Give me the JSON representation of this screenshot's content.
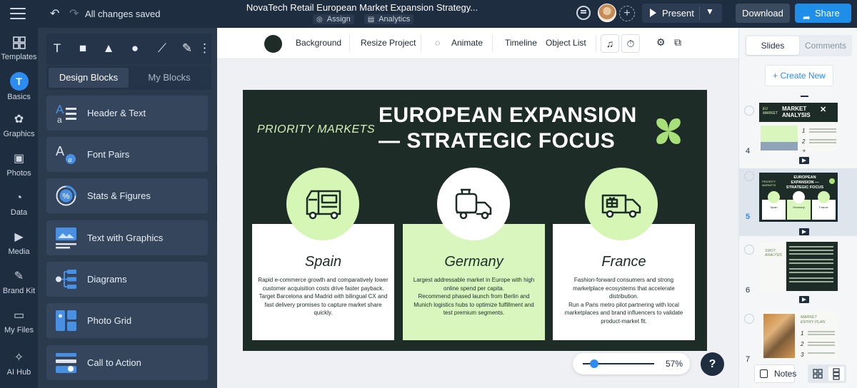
{
  "topbar": {
    "saved_status": "All changes saved",
    "title": "NovaTech Retail European Market Expansion Strategy...",
    "assign_label": "Assign",
    "analytics_label": "Analytics",
    "present_label": "Present",
    "download_label": "Download",
    "share_label": "Share"
  },
  "rail": {
    "items": [
      {
        "label": "Templates",
        "icon": "templates-icon"
      },
      {
        "label": "Basics",
        "icon": "basics-icon"
      },
      {
        "label": "Graphics",
        "icon": "graphics-icon"
      },
      {
        "label": "Photos",
        "icon": "photos-icon"
      },
      {
        "label": "Data",
        "icon": "data-icon"
      },
      {
        "label": "Media",
        "icon": "media-icon"
      },
      {
        "label": "Brand Kit",
        "icon": "brand-kit-icon"
      },
      {
        "label": "My Files",
        "icon": "my-files-icon"
      },
      {
        "label": "AI Hub",
        "icon": "ai-hub-icon"
      }
    ]
  },
  "panel": {
    "tab_design_blocks": "Design Blocks",
    "tab_my_blocks": "My Blocks",
    "blocks": [
      {
        "label": "Header & Text"
      },
      {
        "label": "Font Pairs"
      },
      {
        "label": "Stats & Figures"
      },
      {
        "label": "Text with Graphics"
      },
      {
        "label": "Diagrams"
      },
      {
        "label": "Photo Grid"
      },
      {
        "label": "Call to Action"
      }
    ]
  },
  "context_toolbar": {
    "background_label": "Background",
    "background_color": "#1d2c27",
    "resize_label": "Resize Project",
    "animate_label": "Animate",
    "timeline_label": "Timeline",
    "object_list_label": "Object List"
  },
  "slide": {
    "tagline": "PRIORITY MARKETS",
    "title_line1": "EUROPEAN EXPANSION",
    "title_line2": "— STRATEGIC FOCUS",
    "accent_color": "#a8e07a",
    "cards": [
      {
        "name": "Spain",
        "desc": "Rapid e-commerce growth and comparatively lower customer acquisition costs drive faster payback.\nTarget Barcelona and Madrid with bilingual CX and fast delivery promises to capture market share quickly."
      },
      {
        "name": "Germany",
        "desc": "Largest addressable market in Europe with high online spend per capita.\nRecommend phased launch from Berlin and Munich logistics hubs to optimize fulfillment and test premium segments."
      },
      {
        "name": "France",
        "desc": "Fashion-forward consumers and strong marketplace ecosystems that accelerate distribution.\nRun a Paris metro pilot partnering with local marketplaces and brand influencers to validate product-market fit."
      }
    ]
  },
  "zoom": {
    "value": "57%",
    "level": 0.1
  },
  "right_panel": {
    "tab_slides": "Slides",
    "tab_comments": "Comments",
    "create_new": "+ Create New",
    "thumbnails": [
      {
        "number": "4",
        "t1": "EU MARKET",
        "t2": "MARKET ANALYSIS"
      },
      {
        "number": "5",
        "t1": "PRIORITY MARKETS",
        "t2": "EUROPEAN EXPANSION — STRATEGIC FOCUS",
        "c1": "Spain",
        "c2": "Germany",
        "c3": "France"
      },
      {
        "number": "6",
        "t1": "SWOT ANALYSIS"
      },
      {
        "number": "7",
        "t1": "MARKET ENTRY PLAN"
      }
    ],
    "notes_label": "Notes"
  }
}
